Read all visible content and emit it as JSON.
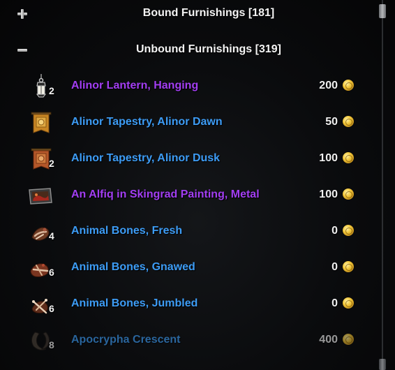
{
  "categories": {
    "bound": {
      "label": "Bound Furnishings [181]",
      "expanded": false,
      "icon": "plus-icon"
    },
    "unbound": {
      "label": "Unbound Furnishings [319]",
      "expanded": true,
      "icon": "minus-icon"
    }
  },
  "colors": {
    "purple_quality": "#a23ef2",
    "blue_quality": "#3d9cf5"
  },
  "items": [
    {
      "icon": "hanging-lantern-icon",
      "quantity": "2",
      "name": "Alinor Lantern, Hanging",
      "quality": "purple",
      "price": "200"
    },
    {
      "icon": "tapestry-icon",
      "quantity": "",
      "name": "Alinor Tapestry, Alinor Dawn",
      "quality": "blue",
      "price": "50"
    },
    {
      "icon": "tapestry-icon",
      "quantity": "2",
      "name": "Alinor Tapestry, Alinor Dusk",
      "quality": "blue",
      "price": "100"
    },
    {
      "icon": "painting-icon",
      "quantity": "",
      "name": "An Alfiq in Skingrad Painting, Metal",
      "quality": "purple",
      "price": "100"
    },
    {
      "icon": "bones-icon",
      "quantity": "4",
      "name": "Animal Bones, Fresh",
      "quality": "blue",
      "price": "0"
    },
    {
      "icon": "bones-icon",
      "quantity": "6",
      "name": "Animal Bones, Gnawed",
      "quality": "blue",
      "price": "0"
    },
    {
      "icon": "bones-icon",
      "quantity": "6",
      "name": "Animal Bones, Jumbled",
      "quality": "blue",
      "price": "0"
    },
    {
      "icon": "crescent-icon",
      "quantity": "8",
      "name": "Apocrypha Crescent",
      "quality": "blue",
      "price": "400"
    }
  ],
  "currency": {
    "icon": "gold-coin-icon"
  }
}
